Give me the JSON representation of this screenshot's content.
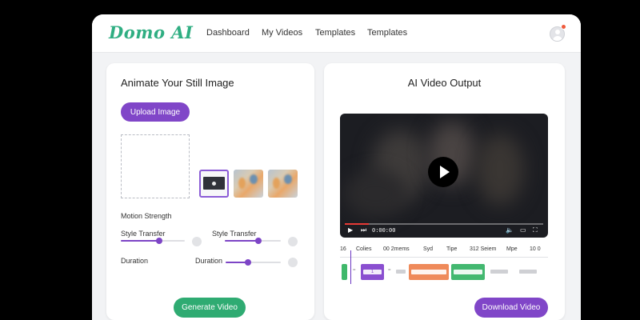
{
  "app": {
    "logo": "Domo AI",
    "nav": [
      "Dashboard",
      "My Videos",
      "Templates",
      "Templates"
    ]
  },
  "left": {
    "title": "Animate Your Still Image",
    "upload_label": "Upload Image",
    "motion_label": "Motion Strength",
    "style_label_1": "Style Transfer",
    "style_label_2": "Style Transfer",
    "style_value_1": 0.6,
    "style_value_2": 0.6,
    "duration_label_1": "Duration",
    "duration_label_2": "Duration",
    "duration_value": 0.4,
    "generate_label": "Generate Video"
  },
  "right": {
    "title": "AI Video Output",
    "timecode": "0:00:00",
    "progress": 0.12,
    "timeline_headers": [
      "16",
      "Colies",
      "00 2mems",
      "Syd",
      "Tipe",
      "312 Seiem",
      "Mpe",
      "10 0"
    ],
    "clip_label": "1",
    "download_label": "Download Video"
  },
  "colors": {
    "brand_green": "#2fae82",
    "accent_purple": "#8046c8",
    "green_button": "#2fab72",
    "notification": "#ef5a3c"
  }
}
